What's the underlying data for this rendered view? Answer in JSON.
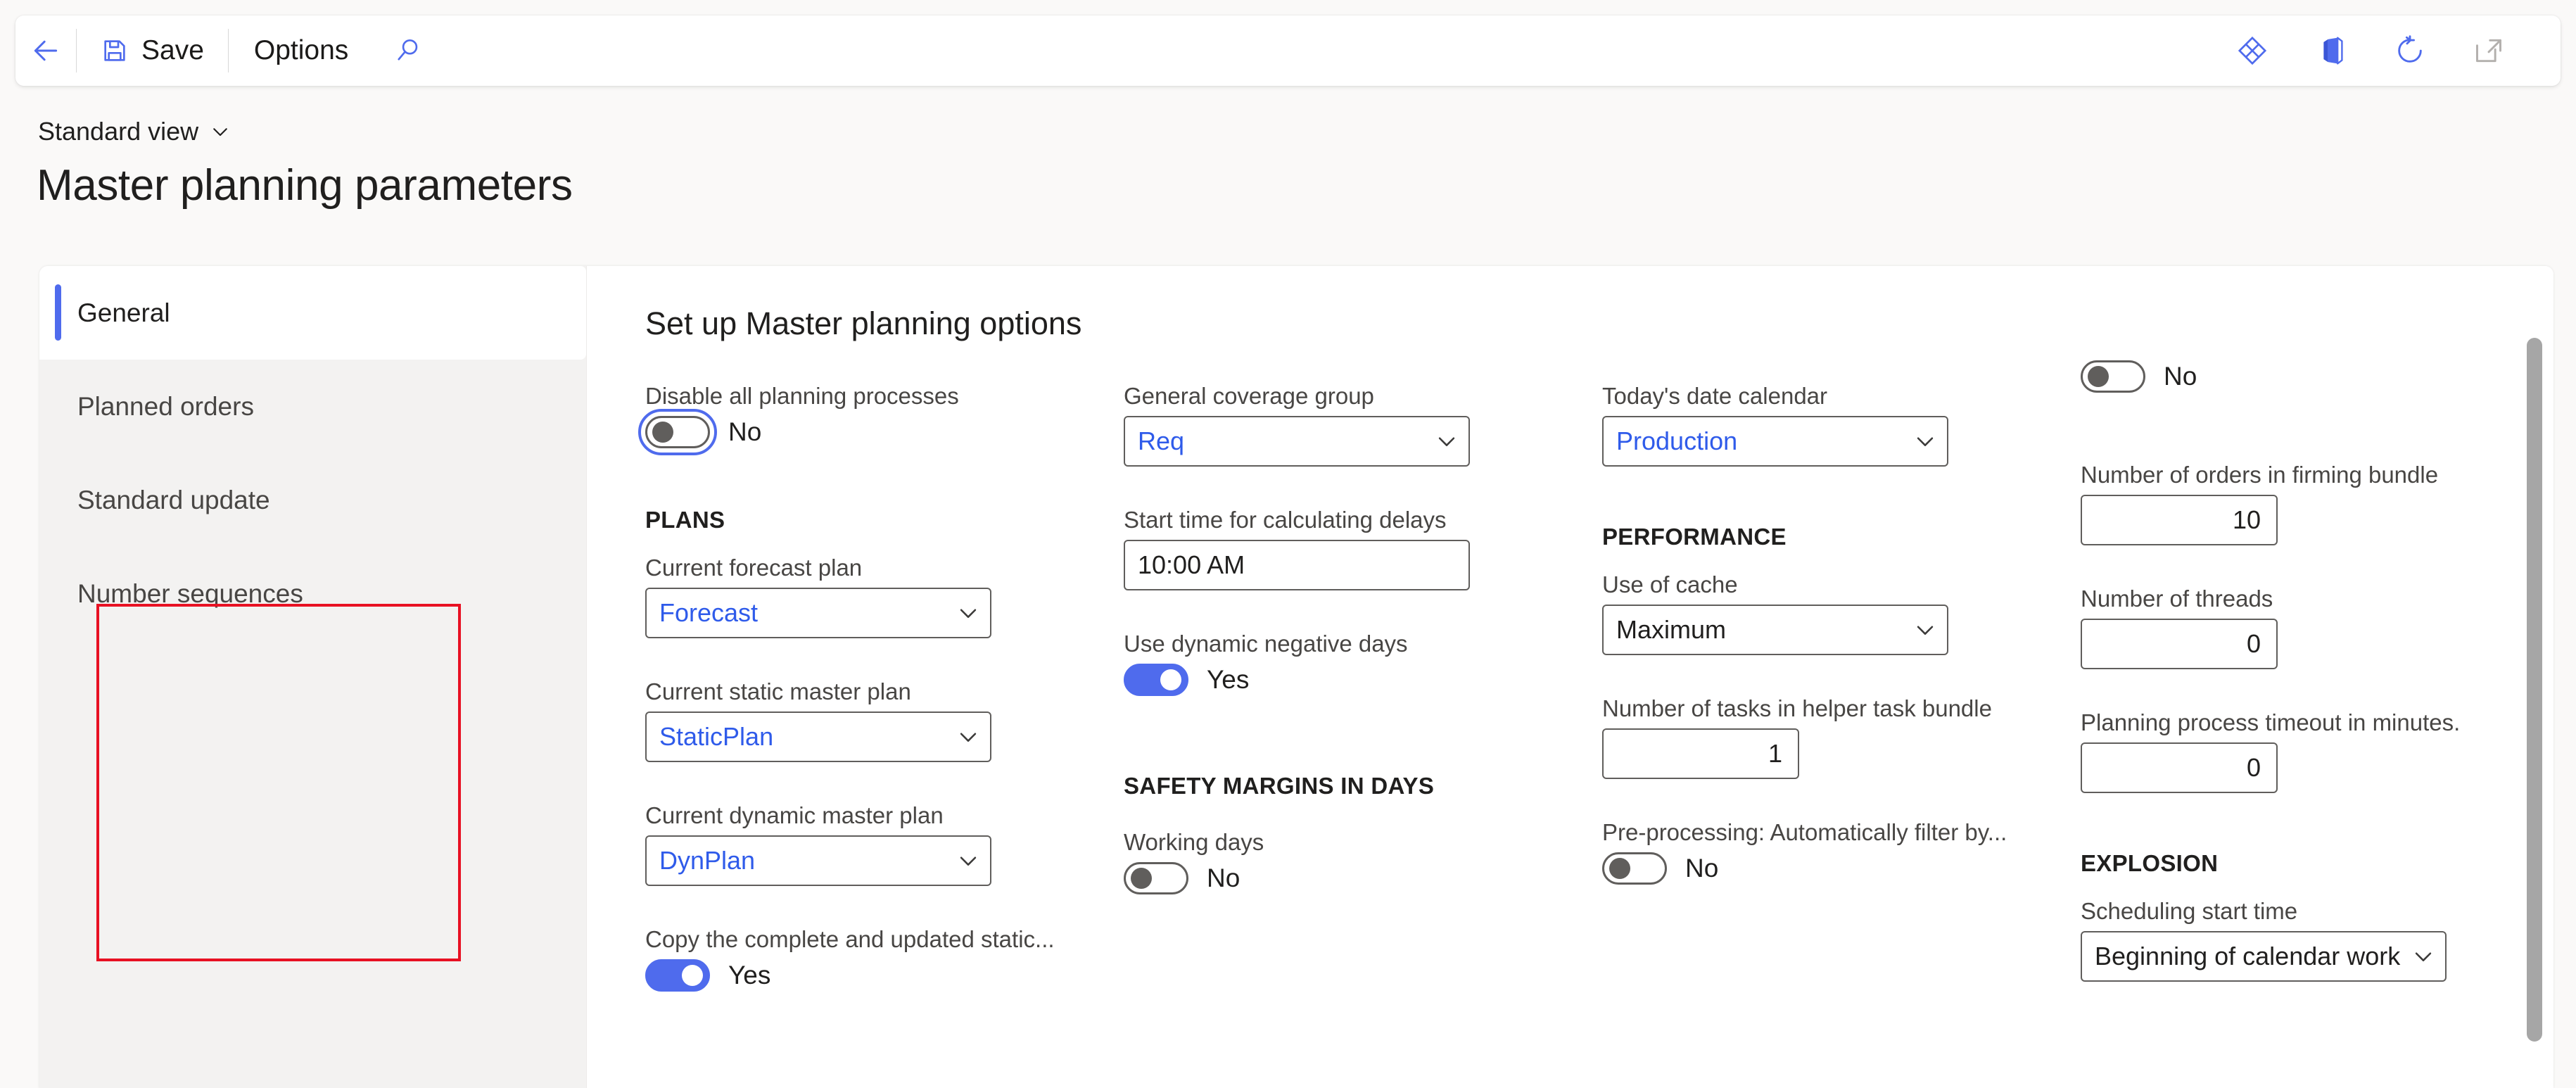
{
  "toolbar": {
    "back_icon": "back-arrow-icon",
    "save_label": "Save",
    "save_icon": "floppy-disk-icon",
    "options_label": "Options",
    "search_icon": "search-icon",
    "right_icons": [
      {
        "name": "personalize-diamond-icon"
      },
      {
        "name": "office-app-launcher-icon"
      },
      {
        "name": "refresh-icon"
      },
      {
        "name": "open-in-new-window-icon"
      }
    ]
  },
  "header": {
    "view_selector": "Standard view",
    "view_chevron": "chevron-down-icon",
    "page_title": "Master planning parameters"
  },
  "nav": {
    "items": [
      {
        "label": "General",
        "selected": true
      },
      {
        "label": "Planned orders",
        "selected": false
      },
      {
        "label": "Standard update",
        "selected": false
      },
      {
        "label": "Number sequences",
        "selected": false
      }
    ]
  },
  "form": {
    "section_title": "Set up Master planning options",
    "col1": {
      "disable_all_label": "Disable all planning processes",
      "disable_all_value": "No",
      "plans_heading": "PLANS",
      "forecast_plan_label": "Current forecast plan",
      "forecast_plan_value": "Forecast",
      "static_plan_label": "Current static master plan",
      "static_plan_value": "StaticPlan",
      "dynamic_plan_label": "Current dynamic master plan",
      "dynamic_plan_value": "DynPlan",
      "copy_static_label": "Copy the complete and updated static...",
      "copy_static_value": "Yes"
    },
    "col2": {
      "coverage_group_label": "General coverage group",
      "coverage_group_value": "Req",
      "start_time_label": "Start time for calculating delays",
      "start_time_value": "10:00 AM",
      "dynamic_negative_days_label": "Use dynamic negative days",
      "dynamic_negative_days_value": "Yes",
      "safety_margins_heading": "SAFETY MARGINS IN DAYS",
      "working_days_label": "Working days",
      "working_days_value": "No"
    },
    "col3": {
      "todays_calendar_label": "Today's date calendar",
      "todays_calendar_value": "Production",
      "performance_heading": "PERFORMANCE",
      "use_of_cache_label": "Use of cache",
      "use_of_cache_value": "Maximum",
      "helper_tasks_label": "Number of tasks in helper task bundle",
      "helper_tasks_value": "1",
      "preprocessing_label": "Pre-processing: Automatically filter by...",
      "preprocessing_value": "No"
    },
    "col4": {
      "top_toggle_value": "No",
      "firming_bundle_label": "Number of orders in firming bundle",
      "firming_bundle_value": "10",
      "threads_label": "Number of threads",
      "threads_value": "0",
      "timeout_label": "Planning process timeout in minutes.",
      "timeout_value": "0",
      "explosion_heading": "EXPLOSION",
      "scheduling_start_label": "Scheduling start time",
      "scheduling_start_value": "Beginning of calendar work d..."
    }
  },
  "colors": {
    "accent": "#4f6bed",
    "link": "#2f5bea",
    "annotation": "#e81123"
  }
}
